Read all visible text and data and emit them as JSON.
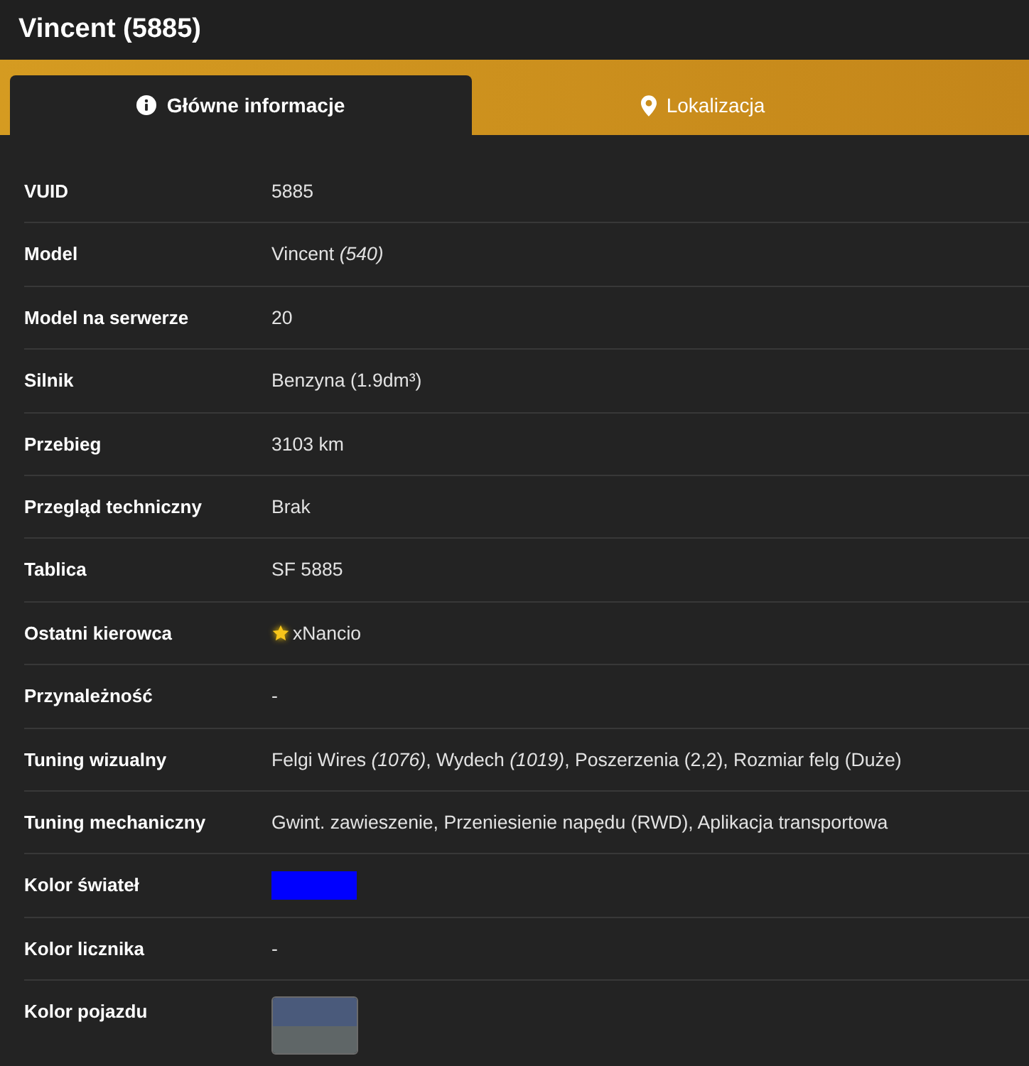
{
  "header": {
    "title": "Vincent (5885)"
  },
  "tabs": [
    {
      "label": "Główne informacje",
      "selected": true
    },
    {
      "label": "Lokalizacja",
      "selected": false
    }
  ],
  "rows": [
    {
      "label": "VUID",
      "kind": "text",
      "value": "5885"
    },
    {
      "label": "Model",
      "kind": "text",
      "value": "Vincent *(540)*"
    },
    {
      "label": "Model na serwerze",
      "kind": "text",
      "value": "20"
    },
    {
      "label": "Silnik",
      "kind": "text",
      "value": "Benzyna (1.9dm³)"
    },
    {
      "label": "Przebieg",
      "kind": "text",
      "value": "3103 km"
    },
    {
      "label": "Przegląd techniczny",
      "kind": "text",
      "value": "Brak"
    },
    {
      "label": "Tablica",
      "kind": "text",
      "value": "SF 5885"
    },
    {
      "label": "Ostatni kierowca",
      "kind": "player",
      "value": "xNancio"
    },
    {
      "label": "Przynależność",
      "kind": "text",
      "value": "-"
    },
    {
      "label": "Tuning wizualny",
      "kind": "text",
      "value": "Felgi Wires *(1076)*, Wydech *(1019)*, Poszerzenia (2,2), Rozmiar felg (Duże)"
    },
    {
      "label": "Tuning mechaniczny",
      "kind": "text",
      "value": "Gwint. zawieszenie, Przeniesienie napędu (RWD), Aplikacja transportowa"
    },
    {
      "label": "Kolor świateł",
      "kind": "color",
      "color": "#0000ff"
    },
    {
      "label": "Kolor licznika",
      "kind": "text",
      "value": "-"
    },
    {
      "label": "Kolor pojazdu",
      "kind": "two_color",
      "swatches": [
        {
          "color": "#4a5a7b"
        },
        {
          "color": "#5f6667"
        }
      ]
    }
  ]
}
